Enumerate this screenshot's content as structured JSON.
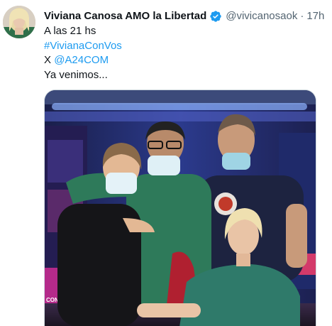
{
  "tweet": {
    "author": {
      "display_name": "Viviana Canosa AMO la Libertad",
      "handle": "@vivicanosaok",
      "verified_icon": "verified-badge-icon"
    },
    "separator": "·",
    "time": "17h",
    "lines": [
      {
        "text": "A las 21 hs",
        "is_link": false
      },
      {
        "text": "#VivianaConVos",
        "is_link": true
      },
      {
        "prefix": "X ",
        "link": "@A24COM"
      },
      {
        "text": "Ya venimos...",
        "is_link": false
      }
    ],
    "media": {
      "overlay_text": "CON VOS"
    }
  },
  "colors": {
    "link": "#1d9bf0",
    "secondary_text": "#536471",
    "verified": "#1d9bf0"
  }
}
